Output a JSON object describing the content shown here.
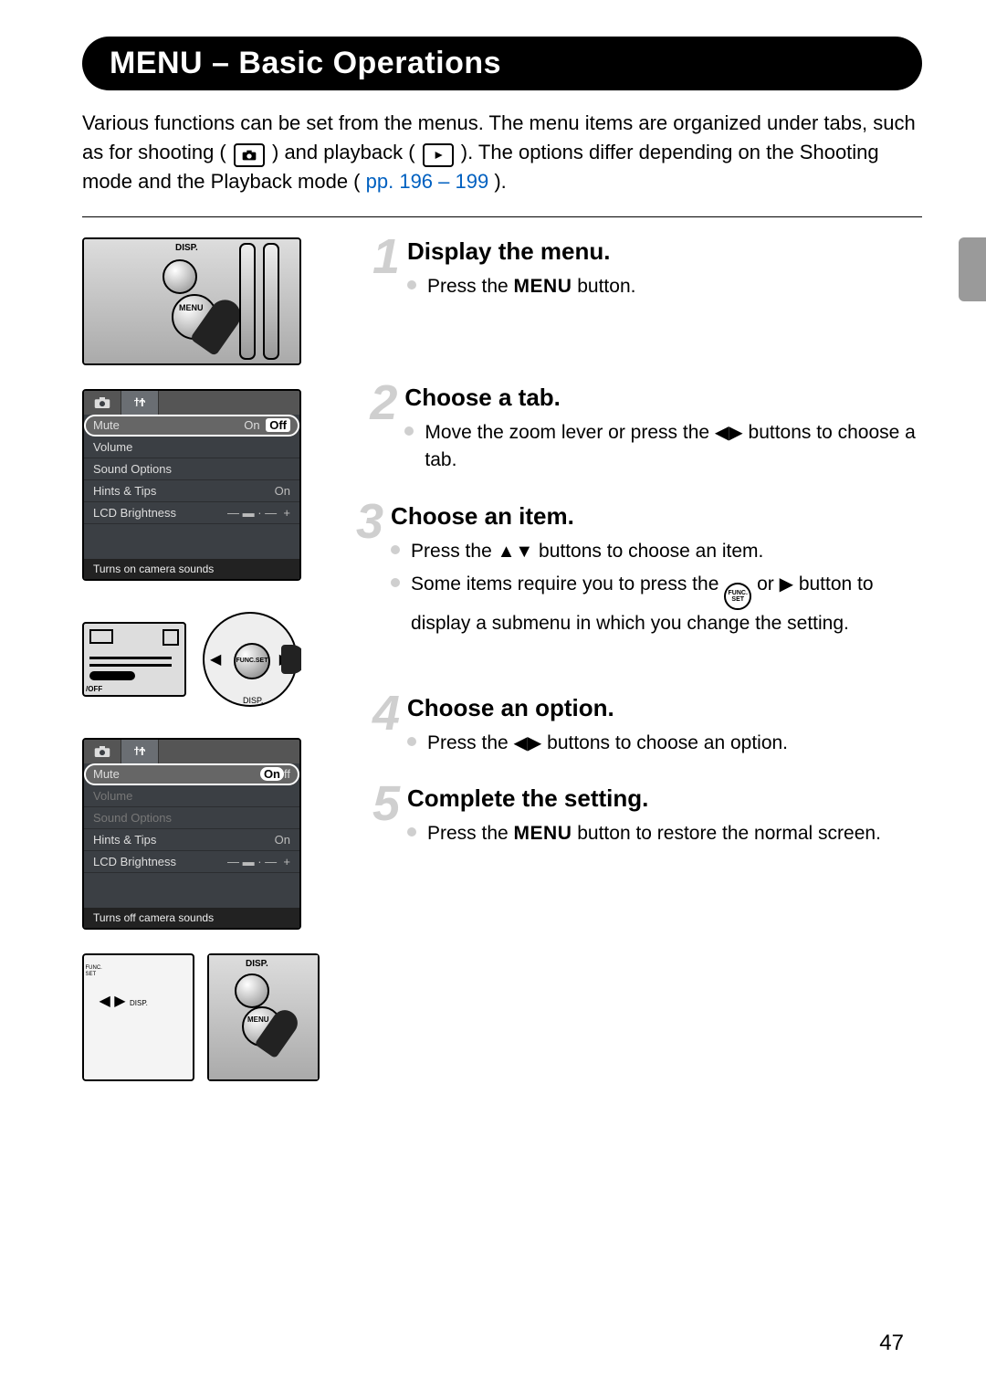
{
  "title": "MENU – Basic Operations",
  "intro": {
    "line1": "Various functions can be set from the menus. The menu items are organized under tabs, such as for shooting (",
    "line2": ") and playback (",
    "line3": "). The options differ depending on the Shooting mode and the Playback mode (",
    "pages": "pp. 196 – 199",
    "close": ")."
  },
  "steps": {
    "s1": {
      "num": "1",
      "head": "Display the menu.",
      "b1a": "Press the ",
      "b1b": " button."
    },
    "s2": {
      "num": "2",
      "head": "Choose a tab.",
      "b1a": "Move the zoom lever or press the ",
      "b1b": " buttons to choose a tab."
    },
    "s3": {
      "num": "3",
      "head": "Choose an item.",
      "b1a": "Press the ",
      "b1b": " buttons to choose an item.",
      "b2a": "Some items require you to press the ",
      "b2b": " or ",
      "b2c": " button to display a submenu in which you change the setting."
    },
    "s4": {
      "num": "4",
      "head": "Choose an option.",
      "b1a": "Press the ",
      "b1b": " buttons to choose an option."
    },
    "s5": {
      "num": "5",
      "head": "Complete the setting.",
      "b1a": "Press the ",
      "b1b": " button to restore the normal screen."
    }
  },
  "menu_glyph": "MENU",
  "func_top": "FUNC.",
  "func_bot": "SET",
  "lcd1": {
    "mute": "Mute",
    "on": "On",
    "off": "Off",
    "volume": "Volume",
    "sound": "Sound Options",
    "hints": "Hints & Tips",
    "hints_val": "On",
    "bright": "LCD Brightness",
    "help": "Turns on camera sounds"
  },
  "lcd2": {
    "mute": "Mute",
    "on": "On",
    "off": "ff",
    "volume": "Volume",
    "sound": "Sound Options",
    "hints": "Hints & Tips",
    "hints_val": "On",
    "bright": "LCD Brightness",
    "help": "Turns off camera sounds"
  },
  "labels": {
    "disp": "DISP.",
    "menu_small": "MENU"
  },
  "page_number": "47"
}
